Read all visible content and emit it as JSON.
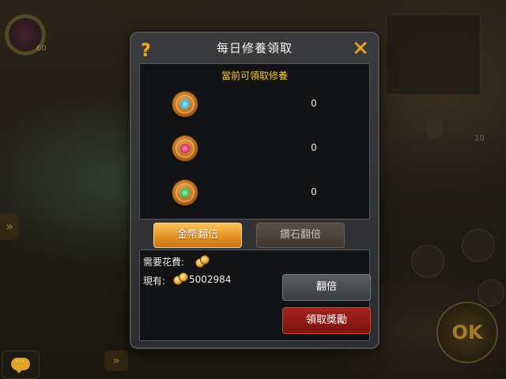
{
  "hud": {
    "level": "60",
    "counter": "10",
    "ok_label": "OK"
  },
  "dialog": {
    "title": "每日修養領取",
    "help_symbol": "?",
    "close_symbol": "✕",
    "rewards_header": "當前可領取修養",
    "rewards": [
      {
        "icon": "heart-emblem-icon",
        "gem_color": "#3fb8e0",
        "value": "0"
      },
      {
        "icon": "ruby-emblem-icon",
        "gem_color": "#e0306a",
        "value": "0"
      },
      {
        "icon": "emerald-emblem-icon",
        "gem_color": "#3fbf5a",
        "value": "0"
      }
    ],
    "tabs": {
      "gold_label": "金幣翻倍",
      "diamond_label": "鑽石翻倍",
      "active": "gold"
    },
    "cost": {
      "required_label": "需要花費:",
      "owned_label": "現有:",
      "owned_amount": "5002984"
    },
    "buttons": {
      "double_label": "翻倍",
      "claim_label": "領取獎勵"
    }
  },
  "colors": {
    "accent_orange": "#f2a628",
    "header_yellow": "#f3c83a",
    "claim_red": "#a5231d"
  }
}
